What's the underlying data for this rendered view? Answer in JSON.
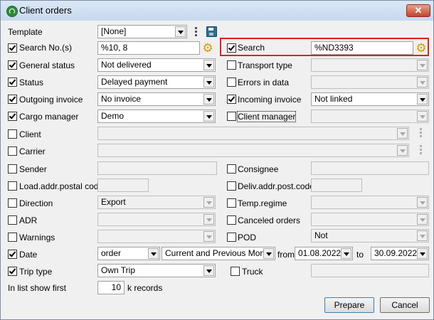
{
  "window": {
    "title": "Client orders",
    "close_glyph": "✕"
  },
  "form": {
    "template": {
      "label": "Template",
      "value": "[None]"
    },
    "search_no": {
      "label": "Search No.(s)",
      "checked": true,
      "value": "%10, 8"
    },
    "search": {
      "label": "Search",
      "checked": true,
      "value": "%ND3393"
    },
    "general_status": {
      "label": "General status",
      "checked": true,
      "value": "Not delivered"
    },
    "transport_type": {
      "label": "Transport type",
      "checked": false,
      "value": ""
    },
    "status": {
      "label": "Status",
      "checked": true,
      "value": "Delayed payment"
    },
    "errors_in_data": {
      "label": "Errors in data",
      "checked": false,
      "value": ""
    },
    "outgoing_invoice": {
      "label": "Outgoing invoice",
      "checked": true,
      "value": "No invoice"
    },
    "incoming_invoice": {
      "label": "Incoming invoice",
      "checked": true,
      "value": "Not linked"
    },
    "cargo_manager": {
      "label": "Cargo manager",
      "checked": true,
      "value": "Demo"
    },
    "client_manager": {
      "label": "Client manager",
      "checked": false,
      "value": ""
    },
    "client": {
      "label": "Client",
      "checked": false,
      "value": ""
    },
    "carrier": {
      "label": "Carrier",
      "checked": false,
      "value": ""
    },
    "sender": {
      "label": "Sender",
      "checked": false,
      "value": ""
    },
    "consignee": {
      "label": "Consignee",
      "checked": false,
      "value": ""
    },
    "load_postal": {
      "label": "Load.addr.postal code",
      "checked": false,
      "value": ""
    },
    "deliv_postal": {
      "label": "Deliv.addr.post.code",
      "checked": false,
      "value": ""
    },
    "direction": {
      "label": "Direction",
      "checked": false,
      "value": "Export"
    },
    "temp_regime": {
      "label": "Temp.regime",
      "checked": false,
      "value": ""
    },
    "adr": {
      "label": "ADR",
      "checked": false,
      "value": ""
    },
    "canceled_orders": {
      "label": "Canceled orders",
      "checked": false,
      "value": ""
    },
    "warnings": {
      "label": "Warnings",
      "checked": false,
      "value": ""
    },
    "pod": {
      "label": "POD",
      "checked": false,
      "value": "Not"
    },
    "date": {
      "label": "Date",
      "checked": true,
      "field": "order",
      "period": "Current and Previous Month",
      "from_label": "from",
      "from": "01.08.2022",
      "to_label": "to",
      "to": "30.09.2022"
    },
    "trip_type": {
      "label": "Trip type",
      "checked": true,
      "value": "Own Trip"
    },
    "truck": {
      "label": "Truck",
      "checked": false,
      "value": ""
    },
    "list_show": {
      "label": "In list show first",
      "value": "10",
      "suffix": "k records"
    }
  },
  "buttons": {
    "prepare": "Prepare",
    "cancel": "Cancel"
  }
}
